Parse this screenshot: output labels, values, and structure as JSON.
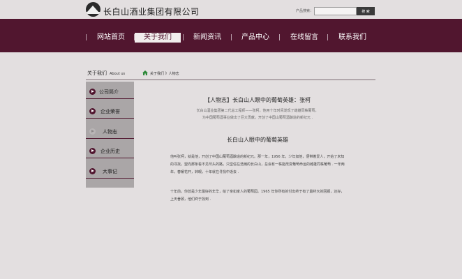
{
  "header": {
    "company_name": "长白山酒业集团有限公司",
    "search_label": "产品搜索：",
    "search_value": "",
    "search_button": "搜 索"
  },
  "nav": {
    "items": [
      {
        "label": "网站首页",
        "active": false
      },
      {
        "label": "关于我们",
        "active": true
      },
      {
        "label": "新闻资讯",
        "active": false
      },
      {
        "label": "产品中心",
        "active": false
      },
      {
        "label": "在线留言",
        "active": false
      },
      {
        "label": "联系我们",
        "active": false
      }
    ]
  },
  "section": {
    "title_cn": "关于我们",
    "title_en": "About us",
    "breadcrumb": "关于我们 》人物志"
  },
  "sidebar": {
    "items": [
      {
        "label": "公司简介",
        "active": true
      },
      {
        "label": "企业荣誉",
        "active": true
      },
      {
        "label": "人物志",
        "active": false
      },
      {
        "label": "企业历史",
        "active": true
      },
      {
        "label": "大事记",
        "active": true
      }
    ]
  },
  "article": {
    "title": "【人物志】长白山人眼中的葡萄英雄：张柯",
    "intro_1": "长白山酒业集团第二代总工程师——张柯，他用十年时间发现了雌雄同株葡萄，",
    "intro_2": "为中国葡萄酒事业做出了巨大贡献，开创了中国山葡萄酒酿造的新纪元 .",
    "subtitle": "长白山人眼中的葡萄英雄",
    "para1": "他叫张柯，就是他，开创了中国山葡萄酒酿造的新纪元。那一年，1956 年，少年如他，便带着爱人，开始了未知的寻找，望向那条看不见尽头的路，只坚信在浩瀚的长白山，总会有一株能改变葡萄命运的雌雄同株葡萄 . 一年两年，春暖花开，转眼，十年就在寻找中逝去 .",
    "para2": "十年前，你曾是少年最好的年华，给了亲如家人的葡萄园。1965 年你所有的付出终于有了最终大的回报，还好，上天眷顾，他们终于找到 ."
  },
  "colors": {
    "brand": "#51162f",
    "background": "#e3dfe0",
    "sidebar": "#aaa6a7"
  },
  "icons": {
    "logo": "mountain-logo-icon",
    "home": "home-icon",
    "bullet": "arrow-bullet-icon"
  }
}
